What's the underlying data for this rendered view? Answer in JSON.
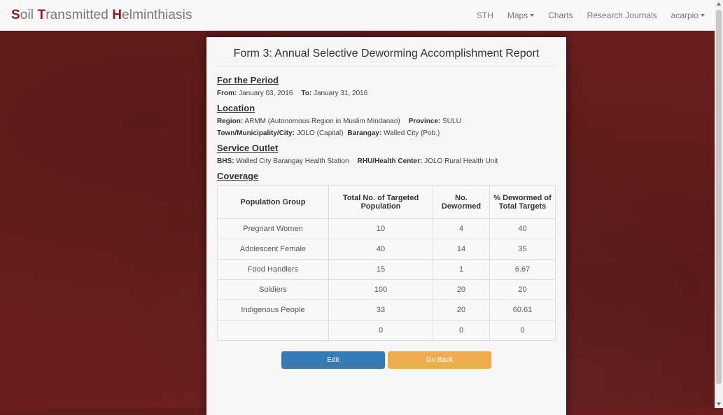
{
  "brand": {
    "letter1": "S",
    "rest1": "oil ",
    "letter2": "T",
    "rest2": "ransmitted ",
    "letter3": "H",
    "rest3": "elminthiasis"
  },
  "nav": {
    "sth": "STH",
    "maps": "Maps",
    "charts": "Charts",
    "journals": "Research Journals",
    "user": "acarpio"
  },
  "form": {
    "title": "Form 3: Annual Selective Deworming Accomplishment Report",
    "period_heading": "For the Period",
    "from_label": "From:",
    "from_value": "January 03, 2016",
    "to_label": "To:",
    "to_value": "January 31, 2016",
    "location_heading": "Location",
    "region_label": "Region:",
    "region_value": "ARMM (Autonomous Region in Muslim Mindanao)",
    "province_label": "Province:",
    "province_value": "SULU",
    "town_label": "Town/Municipality/City:",
    "town_value": "JOLO (Capital)",
    "barangay_label": "Barangay:",
    "barangay_value": "Walled City (Pob.)",
    "outlet_heading": "Service Outlet",
    "bhs_label": "BHS:",
    "bhs_value": "Walled City Barangay Health Station",
    "rhu_label": "RHU/Health Center:",
    "rhu_value": "JOLO Rural Health Unit",
    "coverage_heading": "Coverage",
    "table": {
      "headers": [
        "Population Group",
        "Total No. of Targeted Population",
        "No. Dewormed",
        "% Dewormed of Total Targets"
      ],
      "rows": [
        [
          "Pregnant Women",
          "10",
          "4",
          "40"
        ],
        [
          "Adolescent Female",
          "40",
          "14",
          "35"
        ],
        [
          "Food Handlers",
          "15",
          "1",
          "6.67"
        ],
        [
          "Soldiers",
          "100",
          "20",
          "20"
        ],
        [
          "Indigenous People",
          "33",
          "20",
          "60.61"
        ],
        [
          "",
          "0",
          "0",
          "0"
        ]
      ]
    },
    "edit_label": "Edit",
    "back_label": "Go Back"
  }
}
